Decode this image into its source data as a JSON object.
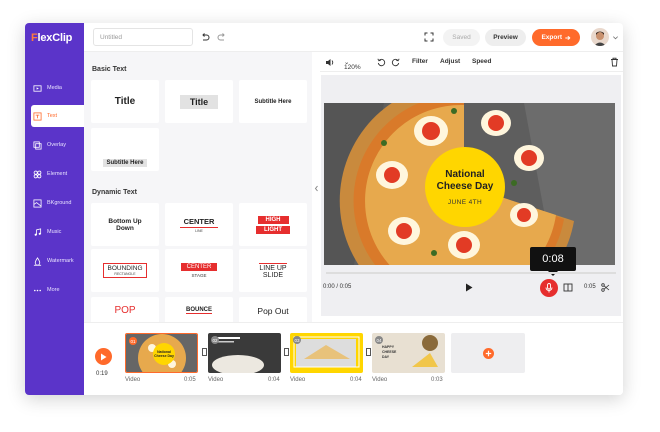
{
  "app": {
    "brand_prefix": "F",
    "brand_rest": "lexClip"
  },
  "sidebar": {
    "items": [
      {
        "label": "Media",
        "icon": "media-icon"
      },
      {
        "label": "Text",
        "icon": "text-icon"
      },
      {
        "label": "Overlay",
        "icon": "overlay-icon"
      },
      {
        "label": "Element",
        "icon": "element-icon"
      },
      {
        "label": "BKground",
        "icon": "background-icon"
      },
      {
        "label": "Music",
        "icon": "music-icon"
      },
      {
        "label": "Watermark",
        "icon": "watermark-icon"
      },
      {
        "label": "More",
        "icon": "more-icon"
      }
    ],
    "active": "Text"
  },
  "topbar": {
    "project_placeholder": "Untitled",
    "saved": "Saved",
    "preview": "Preview",
    "export": "Export"
  },
  "panel": {
    "basic_title": "Basic Text",
    "basic": [
      "Title",
      "Title",
      "Subtitle Here",
      "Subtitle Here"
    ],
    "dynamic_title": "Dynamic Text",
    "dynamic": [
      {
        "l1": "Bottom Up",
        "l2": "Down"
      },
      {
        "l1": "CENTER",
        "l2": "LINE"
      },
      {
        "l1": "HIGH",
        "l2": "LIGHT"
      },
      {
        "l1": "BOUNDING",
        "l2": "RECTANGLE"
      },
      {
        "l1": "CENTER",
        "l2": "STAGE"
      },
      {
        "l1": "LINE UP",
        "l2": "SLIDE"
      },
      {
        "l1": "POP",
        "l2": ""
      },
      {
        "l1": "BOUNCE",
        "l2": ""
      },
      {
        "l1": "Pop Out",
        "l2": ""
      }
    ]
  },
  "editor": {
    "zoom": "120%",
    "filter": "Filter",
    "adjust": "Adjust",
    "speed": "Speed"
  },
  "scene": {
    "title_line1": "National",
    "title_line2": "Cheese Day",
    "date": "JUNE 4TH"
  },
  "player": {
    "record_time": "0:08",
    "current": "0:00 / 0:05",
    "duration": "0:05"
  },
  "timeline": {
    "total": "0:19",
    "clips": [
      {
        "num": "01",
        "type": "Video",
        "dur": "0:05"
      },
      {
        "num": "02",
        "type": "Video",
        "dur": "0:04"
      },
      {
        "num": "03",
        "type": "Video",
        "dur": "0:04"
      },
      {
        "num": "04",
        "type": "Video",
        "dur": "0:03"
      }
    ]
  },
  "colors": {
    "accent": "#ff6a2b",
    "sidebar": "#5b34c9",
    "record": "#e62e2e",
    "badge": "#ffd600"
  }
}
